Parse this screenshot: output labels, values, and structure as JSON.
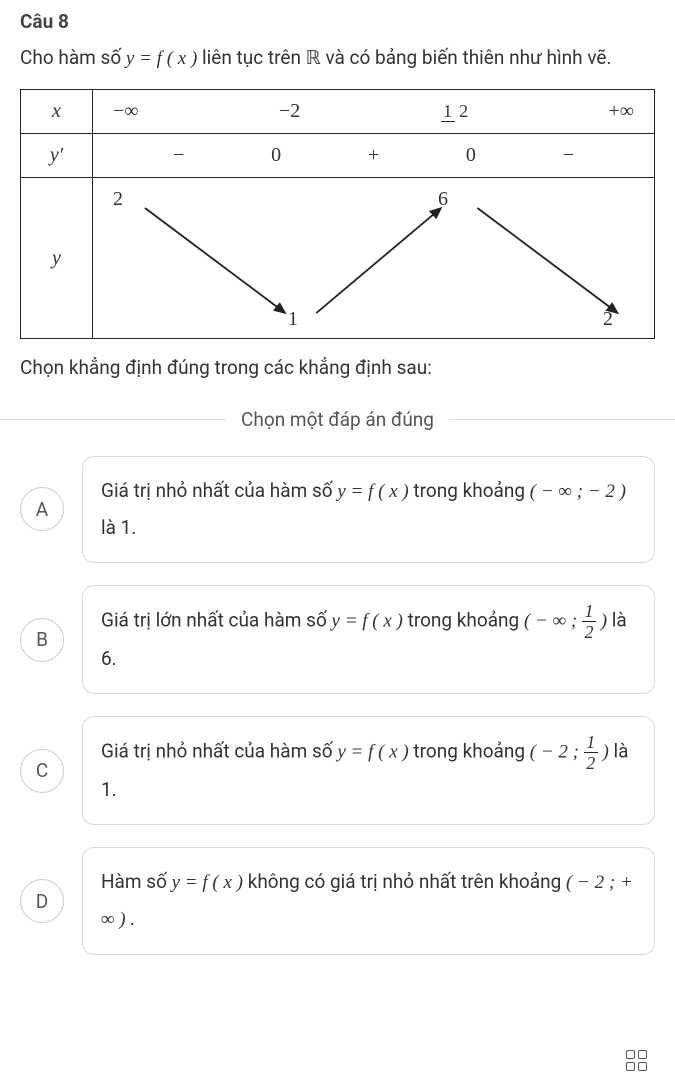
{
  "header": "Câu 8",
  "intro": {
    "p1a": "Cho hàm số ",
    "eq": "y = f ( x )",
    "p1b": " liên tục trên ",
    "R": "ℝ",
    "p1c": " và có bảng biến thiên như hình vẽ."
  },
  "table": {
    "x_label": "x",
    "yp_label": "y′",
    "y_label": "y",
    "x_vals": {
      "neg_inf": "−∞",
      "neg2": "−2",
      "half_num": "1",
      "half_den": "2",
      "pos_inf": "+∞"
    },
    "yp_vals": {
      "m1": "−",
      "z1": "0",
      "p1": "+",
      "z2": "0",
      "m2": "−"
    },
    "y_vals": {
      "v2": "2",
      "v1": "1",
      "v6": "6",
      "v2b": "2"
    }
  },
  "question_after": "Chọn khẳng định đúng trong các khẳng định sau:",
  "instruction": "Chọn một đáp án đúng",
  "choices": {
    "A": {
      "letter": "A",
      "t1": "Giá trị nhỏ nhất của hàm số ",
      "eq": "y = f ( x )",
      "t2": " trong khoảng ",
      "interval": "( − ∞ ; − 2 )",
      "t3": " là 1."
    },
    "B": {
      "letter": "B",
      "t1": "Giá trị lớn nhất của hàm số ",
      "eq": "y = f ( x )",
      "t2": " trong khoảng ",
      "lp": "( − ∞ ; ",
      "half_num": "1",
      "half_den": "2",
      "rp": " )",
      "t3": " là 6."
    },
    "C": {
      "letter": "C",
      "t1": "Giá trị nhỏ nhất của hàm số ",
      "eq": "y = f ( x )",
      "t2": " trong khoảng ",
      "lp": "( − 2 ; ",
      "half_num": "1",
      "half_den": "2",
      "rp": " )",
      "t3": " là 1."
    },
    "D": {
      "letter": "D",
      "t1": "Hàm số ",
      "eq": "y = f ( x )",
      "t2": " không có giá trị nhỏ nhất trên khoảng ",
      "interval": "( − 2 ; + ∞ ) ."
    }
  },
  "chart_data": [
    {
      "type": "table",
      "title": "Bảng biến thiên",
      "rows": [
        {
          "label": "x",
          "cells": [
            "−∞",
            "−2",
            "1/2",
            "+∞"
          ]
        },
        {
          "label": "y′",
          "cells": [
            "−",
            "0",
            "+",
            "0",
            "−"
          ]
        },
        {
          "label": "y",
          "start": 2,
          "points": [
            {
              "x": "−2",
              "y": 1
            },
            {
              "x": "1/2",
              "y": 6
            }
          ],
          "end": 2,
          "direction": [
            "down",
            "up",
            "down"
          ]
        }
      ]
    }
  ]
}
